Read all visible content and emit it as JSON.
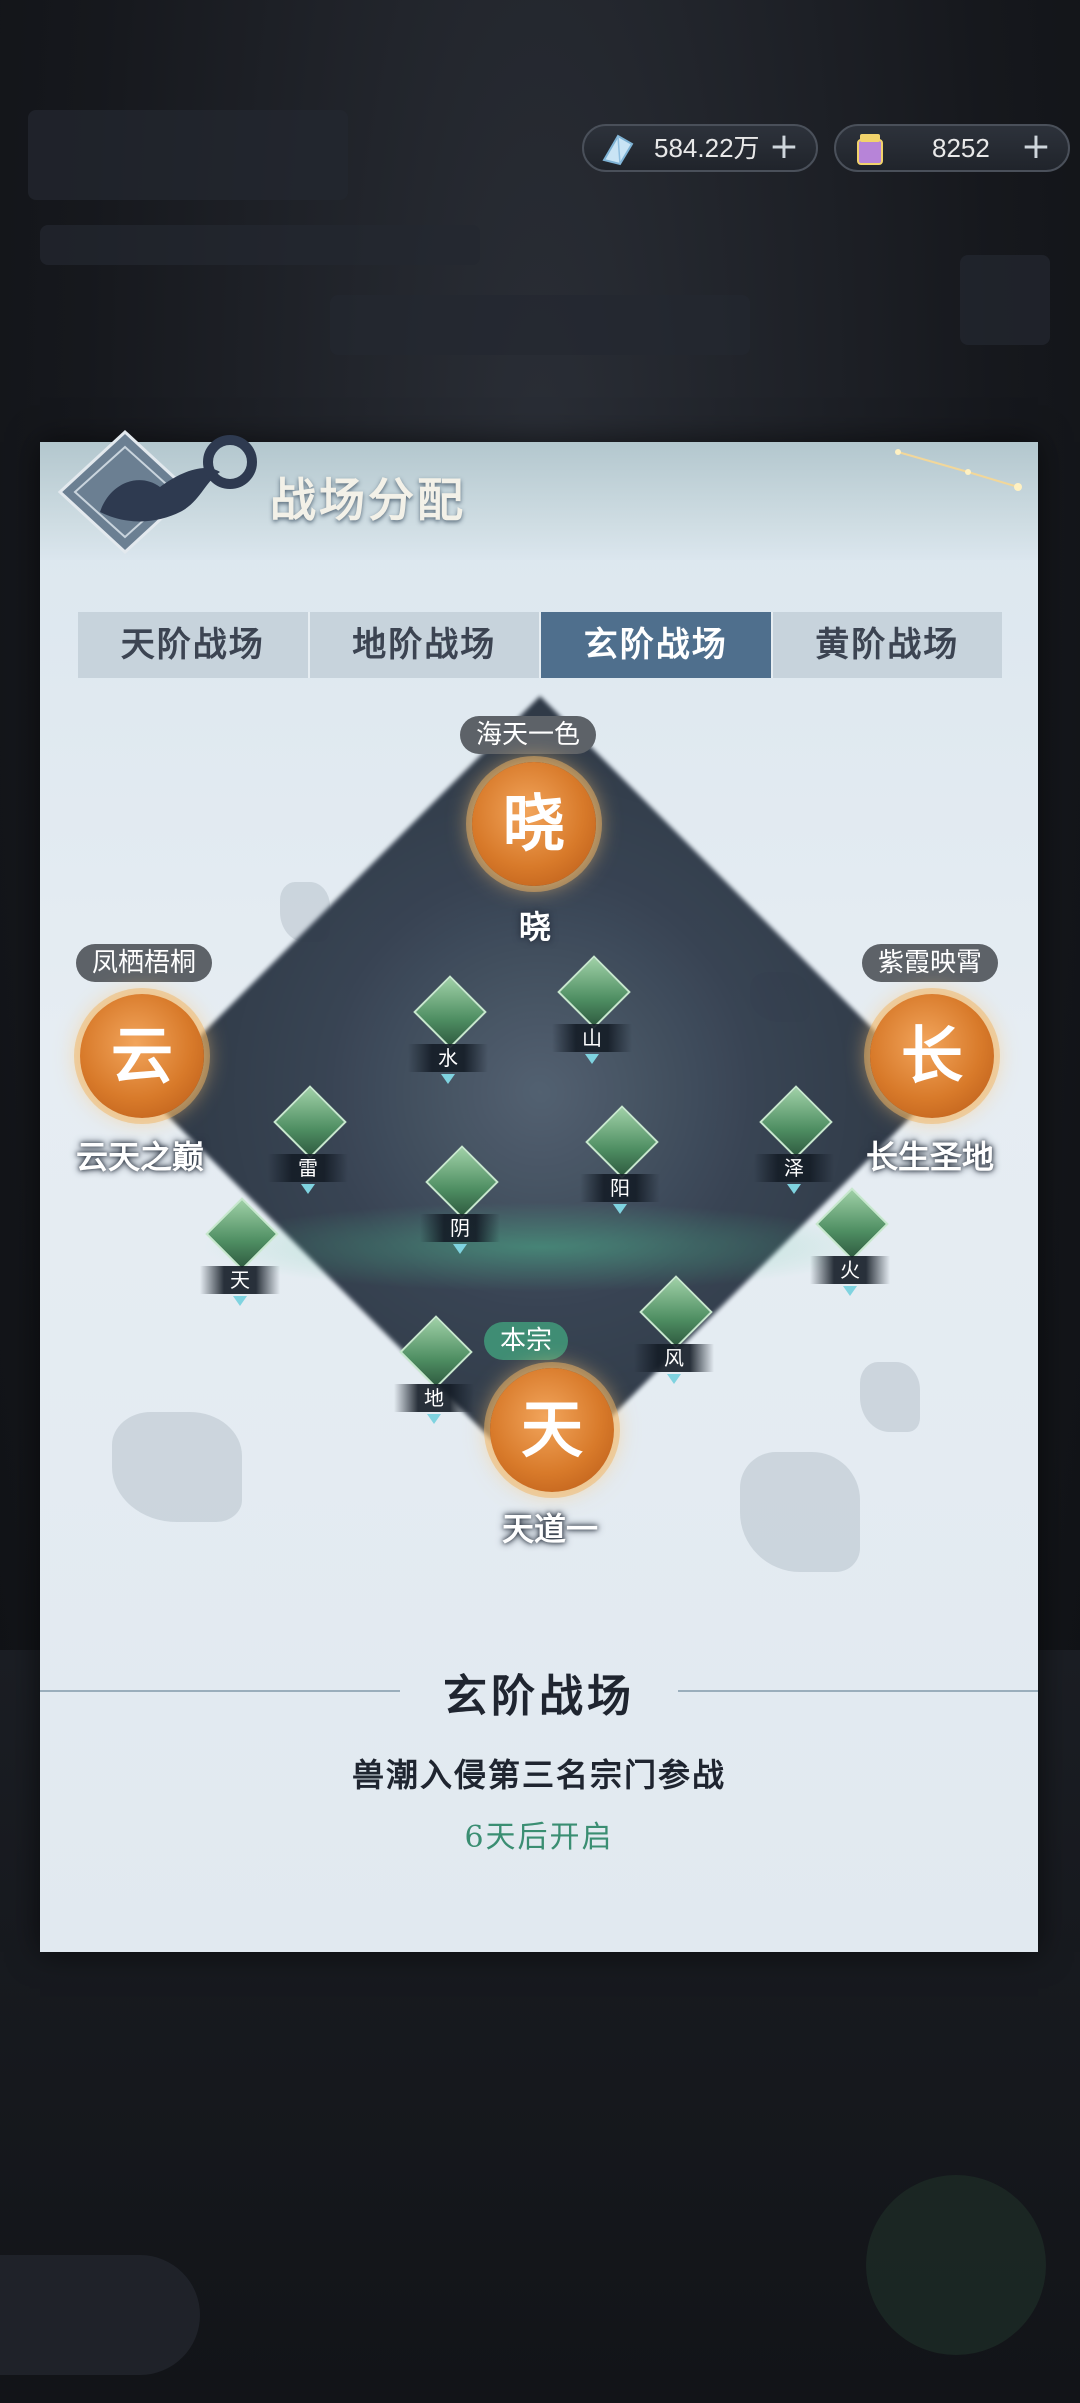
{
  "currency": {
    "crystal_value": "584.22万",
    "scroll_value": "8252",
    "add_label": "+"
  },
  "dialog": {
    "title": "战场分配",
    "tabs": [
      "天阶战场",
      "地阶战场",
      "玄阶战场",
      "黄阶战场"
    ],
    "active_tab": 2
  },
  "map": {
    "top": {
      "tag": "海天一色",
      "char": "晓",
      "name": "晓"
    },
    "left": {
      "tag": "凤栖梧桐",
      "char": "云",
      "name": "云天之巅"
    },
    "right": {
      "tag": "紫霞映霄",
      "char": "长",
      "name": "长生圣地"
    },
    "bottom": {
      "tag": "本宗",
      "char": "天",
      "name": "天道一"
    },
    "nodes": {
      "shui": "水",
      "shan": "山",
      "lei": "雷",
      "yin": "阴",
      "yang": "阳",
      "ze": "泽",
      "tian": "天",
      "huo": "火",
      "di": "地",
      "feng": "风"
    }
  },
  "info": {
    "title": "玄阶战场",
    "description": "兽潮入侵第三名宗门参战",
    "timer": "6天后开启"
  },
  "colors": {
    "accent_orange": "#d87a2a",
    "active_tab": "#4f6f8d",
    "timer_green": "#3a8e72",
    "self_tag": "#3f8d74"
  }
}
